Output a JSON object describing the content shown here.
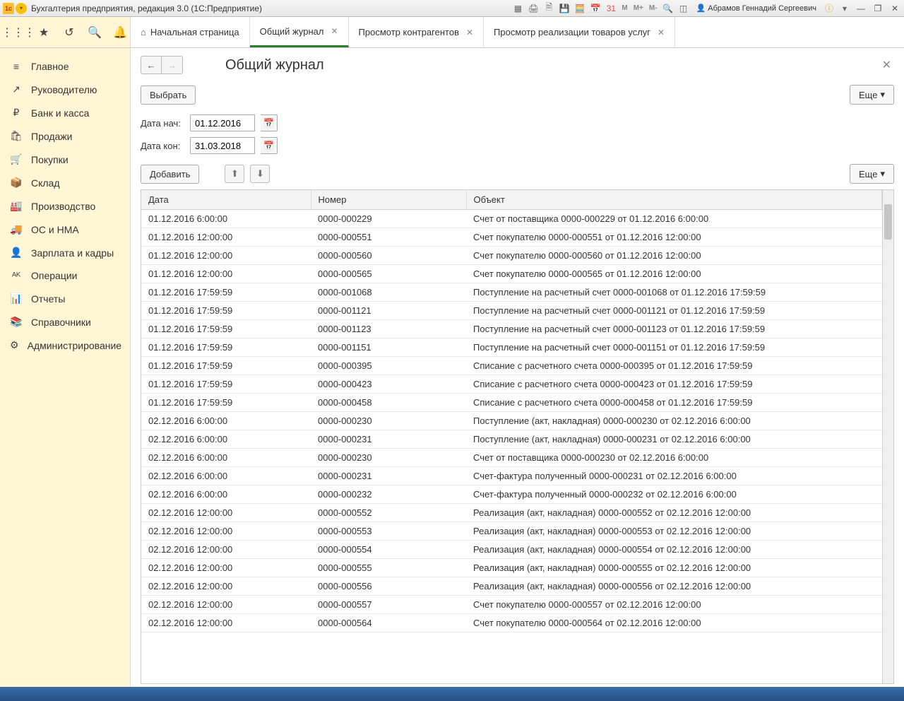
{
  "title": "Бухгалтерия предприятия, редакция 3.0  (1С:Предприятие)",
  "user": "Абрамов Геннадий Сергеевич",
  "m_btns": [
    "M",
    "M+",
    "M-"
  ],
  "tabs": [
    {
      "label": "Начальная страница",
      "closable": false,
      "home": true
    },
    {
      "label": "Общий журнал",
      "closable": true,
      "active": true
    },
    {
      "label": "Просмотр контрагентов",
      "closable": true
    },
    {
      "label": "Просмотр реализации товаров услуг",
      "closable": true
    }
  ],
  "sidebar": [
    {
      "icon": "≡",
      "label": "Главное"
    },
    {
      "icon": "↗",
      "label": "Руководителю"
    },
    {
      "icon": "₽",
      "label": "Банк и касса"
    },
    {
      "icon": "🛍",
      "label": "Продажи"
    },
    {
      "icon": "🛒",
      "label": "Покупки"
    },
    {
      "icon": "📦",
      "label": "Склад"
    },
    {
      "icon": "🏭",
      "label": "Производство"
    },
    {
      "icon": "🚚",
      "label": "ОС и НМА"
    },
    {
      "icon": "👤",
      "label": "Зарплата и кадры"
    },
    {
      "icon": "ᴬᴷ",
      "label": "Операции"
    },
    {
      "icon": "📊",
      "label": "Отчеты"
    },
    {
      "icon": "📚",
      "label": "Справочники"
    },
    {
      "icon": "⚙",
      "label": "Администрирование"
    }
  ],
  "page": {
    "title": "Общий журнал",
    "select_btn": "Выбрать",
    "more_btn": "Еще",
    "date_from_label": "Дата нач:",
    "date_from": "01.12.2016",
    "date_to_label": "Дата кон:",
    "date_to": "31.03.2018",
    "add_btn": "Добавить",
    "more_btn2": "Еще"
  },
  "table": {
    "cols": {
      "date": "Дата",
      "num": "Номер",
      "obj": "Объект"
    },
    "rows": [
      {
        "date": "01.12.2016 6:00:00",
        "num": "0000-000229",
        "obj": "Счет от поставщика 0000-000229 от 01.12.2016 6:00:00"
      },
      {
        "date": "01.12.2016 12:00:00",
        "num": "0000-000551",
        "obj": "Счет покупателю 0000-000551 от 01.12.2016 12:00:00"
      },
      {
        "date": "01.12.2016 12:00:00",
        "num": "0000-000560",
        "obj": "Счет покупателю 0000-000560 от 01.12.2016 12:00:00"
      },
      {
        "date": "01.12.2016 12:00:00",
        "num": "0000-000565",
        "obj": "Счет покупателю 0000-000565 от 01.12.2016 12:00:00"
      },
      {
        "date": "01.12.2016 17:59:59",
        "num": "0000-001068",
        "obj": "Поступление на расчетный счет 0000-001068 от 01.12.2016 17:59:59"
      },
      {
        "date": "01.12.2016 17:59:59",
        "num": "0000-001121",
        "obj": "Поступление на расчетный счет 0000-001121 от 01.12.2016 17:59:59"
      },
      {
        "date": "01.12.2016 17:59:59",
        "num": "0000-001123",
        "obj": "Поступление на расчетный счет 0000-001123 от 01.12.2016 17:59:59"
      },
      {
        "date": "01.12.2016 17:59:59",
        "num": "0000-001151",
        "obj": "Поступление на расчетный счет 0000-001151 от 01.12.2016 17:59:59"
      },
      {
        "date": "01.12.2016 17:59:59",
        "num": "0000-000395",
        "obj": "Списание с расчетного счета 0000-000395 от 01.12.2016 17:59:59"
      },
      {
        "date": "01.12.2016 17:59:59",
        "num": "0000-000423",
        "obj": "Списание с расчетного счета 0000-000423 от 01.12.2016 17:59:59"
      },
      {
        "date": "01.12.2016 17:59:59",
        "num": "0000-000458",
        "obj": "Списание с расчетного счета 0000-000458 от 01.12.2016 17:59:59"
      },
      {
        "date": "02.12.2016 6:00:00",
        "num": "0000-000230",
        "obj": "Поступление (акт, накладная) 0000-000230 от 02.12.2016 6:00:00"
      },
      {
        "date": "02.12.2016 6:00:00",
        "num": "0000-000231",
        "obj": "Поступление (акт, накладная) 0000-000231 от 02.12.2016 6:00:00"
      },
      {
        "date": "02.12.2016 6:00:00",
        "num": "0000-000230",
        "obj": "Счет от поставщика 0000-000230 от 02.12.2016 6:00:00"
      },
      {
        "date": "02.12.2016 6:00:00",
        "num": "0000-000231",
        "obj": "Счет-фактура полученный 0000-000231 от 02.12.2016 6:00:00"
      },
      {
        "date": "02.12.2016 6:00:00",
        "num": "0000-000232",
        "obj": "Счет-фактура полученный 0000-000232 от 02.12.2016 6:00:00"
      },
      {
        "date": "02.12.2016 12:00:00",
        "num": "0000-000552",
        "obj": "Реализация (акт, накладная) 0000-000552 от 02.12.2016 12:00:00"
      },
      {
        "date": "02.12.2016 12:00:00",
        "num": "0000-000553",
        "obj": "Реализация (акт, накладная) 0000-000553 от 02.12.2016 12:00:00"
      },
      {
        "date": "02.12.2016 12:00:00",
        "num": "0000-000554",
        "obj": "Реализация (акт, накладная) 0000-000554 от 02.12.2016 12:00:00"
      },
      {
        "date": "02.12.2016 12:00:00",
        "num": "0000-000555",
        "obj": "Реализация (акт, накладная) 0000-000555 от 02.12.2016 12:00:00"
      },
      {
        "date": "02.12.2016 12:00:00",
        "num": "0000-000556",
        "obj": "Реализация (акт, накладная) 0000-000556 от 02.12.2016 12:00:00"
      },
      {
        "date": "02.12.2016 12:00:00",
        "num": "0000-000557",
        "obj": "Счет покупателю 0000-000557 от 02.12.2016 12:00:00"
      },
      {
        "date": "02.12.2016 12:00:00",
        "num": "0000-000564",
        "obj": "Счет покупателю 0000-000564 от 02.12.2016 12:00:00"
      }
    ]
  }
}
